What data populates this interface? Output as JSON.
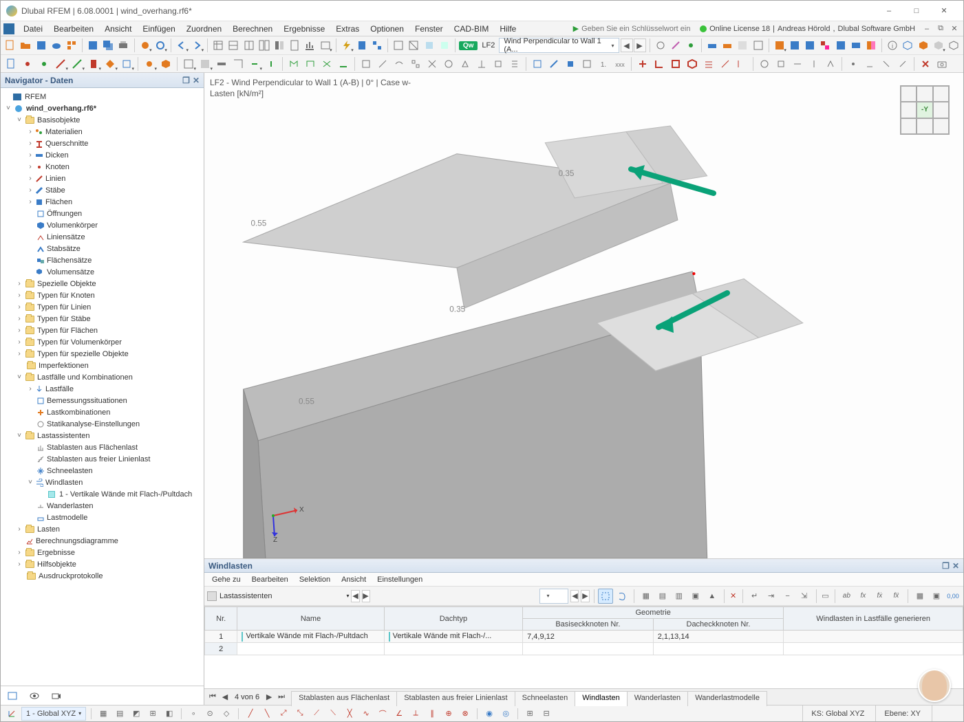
{
  "title": {
    "app": "Dlubal RFEM",
    "version": "6.08.0001",
    "file": "wind_overhang.rf6*"
  },
  "menus": [
    "Datei",
    "Bearbeiten",
    "Ansicht",
    "Einfügen",
    "Zuordnen",
    "Berechnen",
    "Ergebnisse",
    "Extras",
    "Optionen",
    "Fenster",
    "CAD-BIM",
    "Hilfe"
  ],
  "search_placeholder": "Geben Sie ein Schlüsselwort ein (Alt+Q)",
  "license": {
    "label": "Online License 18",
    "user": "Andreas Hörold",
    "company": "Dlubal Software GmbH"
  },
  "toolbar": {
    "lf_chip": "Qw",
    "lf_label": "LF2",
    "lf_combo": "Wind Perpendicular to Wall 1 (A..."
  },
  "navigator": {
    "title": "Navigator - Daten",
    "root": "RFEM",
    "model": "wind_overhang.rf6*",
    "groups": {
      "basic": "Basisobjekte",
      "basic_items": [
        "Materialien",
        "Querschnitte",
        "Dicken",
        "Knoten",
        "Linien",
        "Stäbe",
        "Flächen",
        "Öffnungen",
        "Volumenkörper",
        "Liniensätze",
        "Stabsätze",
        "Flächensätze",
        "Volumensätze"
      ],
      "special": "Spezielle Objekte",
      "types_knoten": "Typen für Knoten",
      "types_linien": "Typen für Linien",
      "types_staebe": "Typen für Stäbe",
      "types_flaechen": "Typen für Flächen",
      "types_volumen": "Typen für Volumenkörper",
      "types_special": "Typen für spezielle Objekte",
      "imperf": "Imperfektionen",
      "lf_combo": "Lastfälle und Kombinationen",
      "lf_items": [
        "Lastfälle",
        "Bemessungssituationen",
        "Lastkombinationen",
        "Statikanalyse-Einstellungen"
      ],
      "assistants": "Lastassistenten",
      "assist_items": [
        "Stablasten aus Flächenlast",
        "Stablasten aus freier Linienlast",
        "Schneelasten",
        "Windlasten"
      ],
      "wind_sub": "1 - Vertikale Wände mit Flach-/Pultdach",
      "assist_tail": [
        "Wanderlasten",
        "Lastmodelle"
      ],
      "lasten": "Lasten",
      "berech": "Berechnungsdiagramme",
      "ergeb": "Ergebnisse",
      "hilfs": "Hilfsobjekte",
      "ausdruck": "Ausdruckprotokolle"
    }
  },
  "viewport": {
    "title_line1": "LF2 - Wind Perpendicular to Wall 1 (A-B) | 0° | Case w-",
    "title_line2": "Lasten [kN/m²]",
    "labels": {
      "v1": "0.35",
      "v2": "0.55",
      "v3": "0.35",
      "v4": "0.55"
    },
    "orient_face": "-Y",
    "axes": {
      "x": "X",
      "z": "Z"
    }
  },
  "lower": {
    "title": "Windlasten",
    "menus": [
      "Gehe zu",
      "Bearbeiten",
      "Selektion",
      "Ansicht",
      "Einstellungen"
    ],
    "dropdown": "Lastassistenten",
    "columns": {
      "nr": "Nr.",
      "name": "Name",
      "dachtyp": "Dachtyp",
      "geo": "Geometrie",
      "basiseck": "Basiseckknoten Nr.",
      "dacheck": "Dacheckknoten Nr.",
      "gen": "Windlasten in Lastfälle generieren"
    },
    "rows": [
      {
        "nr": "1",
        "name": "Vertikale Wände mit Flach-/Pultdach",
        "dachtyp": "Vertikale Wände mit Flach-/...",
        "basis": "7,4,9,12",
        "dach": "2,1,13,14",
        "gen": ""
      },
      {
        "nr": "2",
        "name": "",
        "dachtyp": "",
        "basis": "",
        "dach": "",
        "gen": ""
      }
    ],
    "paging": "4 von 6",
    "tabs": [
      "Stablasten aus Flächenlast",
      "Stablasten aus freier Linienlast",
      "Schneelasten",
      "Windlasten",
      "Wanderlasten",
      "Wanderlastmodelle"
    ],
    "active_tab": 3
  },
  "status": {
    "cs_combo": "1 - Global XYZ",
    "ks": "KS: Global XYZ",
    "ebene": "Ebene: XY"
  }
}
